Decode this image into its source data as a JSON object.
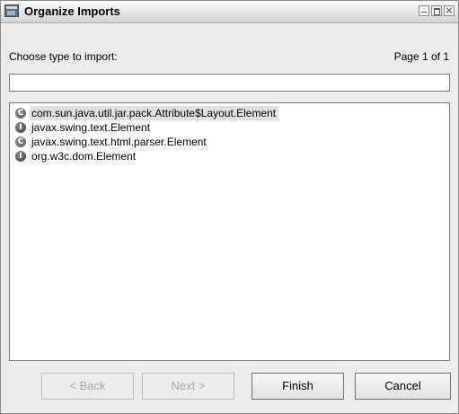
{
  "window": {
    "title": "Organize Imports"
  },
  "prompt": {
    "label": "Choose type to import:",
    "page_indicator": "Page 1 of 1"
  },
  "search": {
    "value": "",
    "placeholder": ""
  },
  "results": [
    {
      "label": "com.sun.java.util.jar.pack.Attribute$Layout.Element",
      "kind": "class",
      "icon_glyph": "C",
      "selected": true
    },
    {
      "label": "javax.swing.text.Element",
      "kind": "interface",
      "icon_glyph": "I",
      "selected": false
    },
    {
      "label": "javax.swing.text.html.parser.Element",
      "kind": "class",
      "icon_glyph": "C",
      "selected": false
    },
    {
      "label": "org.w3c.dom.Element",
      "kind": "interface",
      "icon_glyph": "I",
      "selected": false
    }
  ],
  "buttons": {
    "back_label": "< Back",
    "next_label": "Next >",
    "finish_label": "Finish",
    "cancel_label": "Cancel"
  },
  "icons": {
    "app": "organize-imports-app-icon",
    "minimize": "minimize-icon",
    "maximize": "maximize-icon",
    "close": "close-icon"
  },
  "colors": {
    "dialog_background": "#ececec",
    "selection_background": "#e0e0e0",
    "disabled_text": "#a8a8a8"
  }
}
